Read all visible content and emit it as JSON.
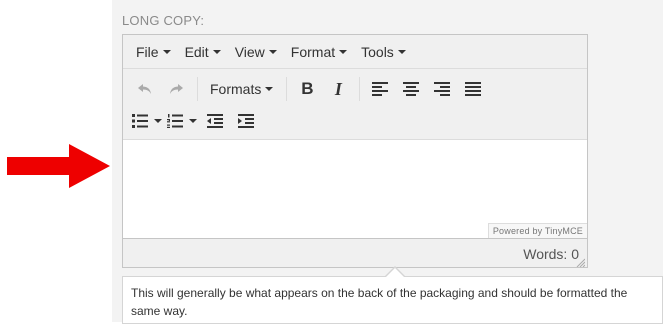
{
  "field": {
    "label": "LONG COPY:"
  },
  "menubar": {
    "items": [
      {
        "label": "File"
      },
      {
        "label": "Edit"
      },
      {
        "label": "View"
      },
      {
        "label": "Format"
      },
      {
        "label": "Tools"
      }
    ]
  },
  "toolbar": {
    "formats_label": "Formats",
    "bold_label": "B",
    "italic_label": "I",
    "icons": [
      "undo-icon",
      "redo-icon",
      "align-left-icon",
      "align-center-icon",
      "align-right-icon",
      "align-justify-icon",
      "bullet-list-icon",
      "numbered-list-icon",
      "outdent-icon",
      "indent-icon"
    ]
  },
  "editor": {
    "content": "",
    "powered_by": "Powered by TinyMCE"
  },
  "statusbar": {
    "word_count": "Words: 0"
  },
  "help": {
    "text": "This will generally be what appears on the back of the packaging and should be formatted the same way."
  },
  "colors": {
    "arrow": "#ee0000",
    "panel_bg": "#f3f3f3",
    "label": "#8a8a8a"
  }
}
